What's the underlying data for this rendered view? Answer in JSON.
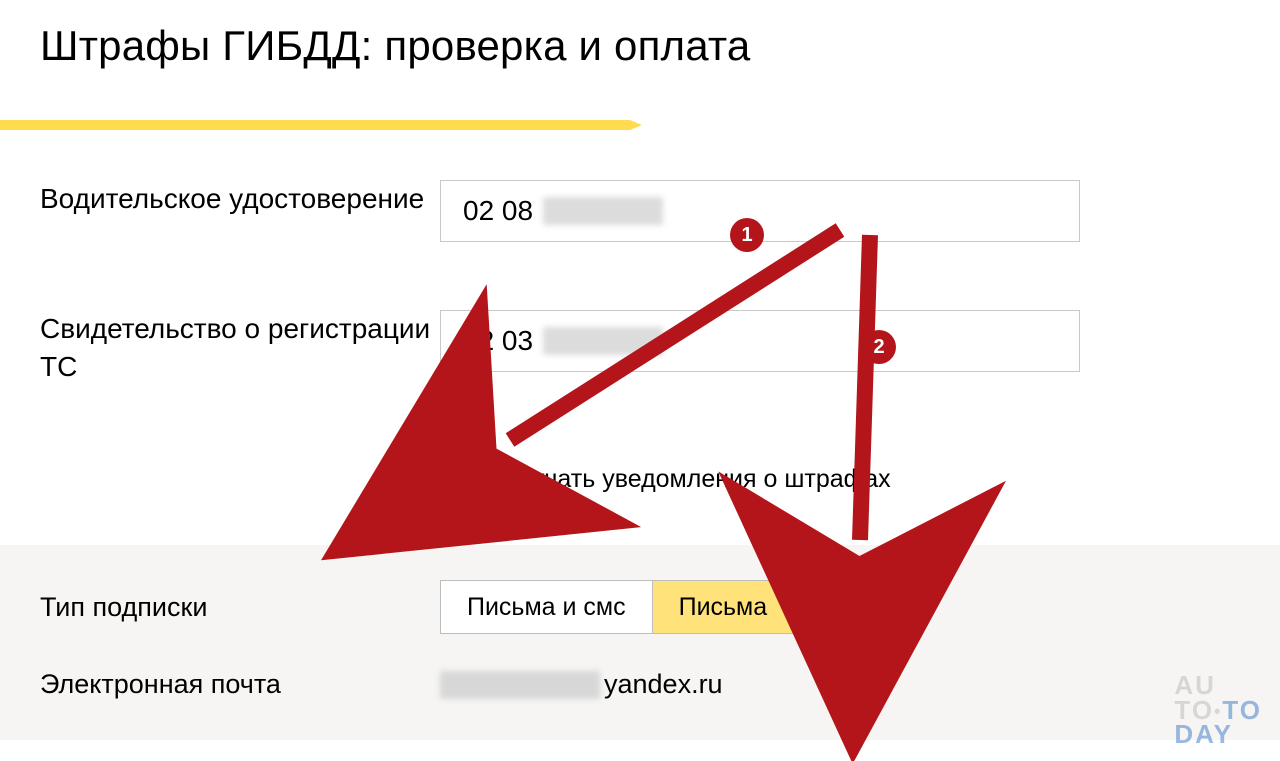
{
  "title": "Штрафы ГИБДД: проверка и оплата",
  "fields": {
    "license_label": "Водительское удостоверение",
    "license_value_visible": "02 08",
    "reg_label": "Свидетельство о регистрации ТС",
    "reg_value_visible": "02 03"
  },
  "checkbox": {
    "checked": true,
    "label": "Получать уведомления о штрафах"
  },
  "subscription": {
    "type_label": "Тип подписки",
    "options": [
      "Письма и смс",
      "Письма"
    ],
    "active_index": 1,
    "email_label": "Электронная почта",
    "email_domain": "yandex.ru"
  },
  "annotations": {
    "badge1": "1",
    "badge2": "2"
  },
  "watermark": {
    "l1a": "AU",
    "l2a": "TO",
    "l2b": "TO",
    "l3a": "DAY"
  }
}
